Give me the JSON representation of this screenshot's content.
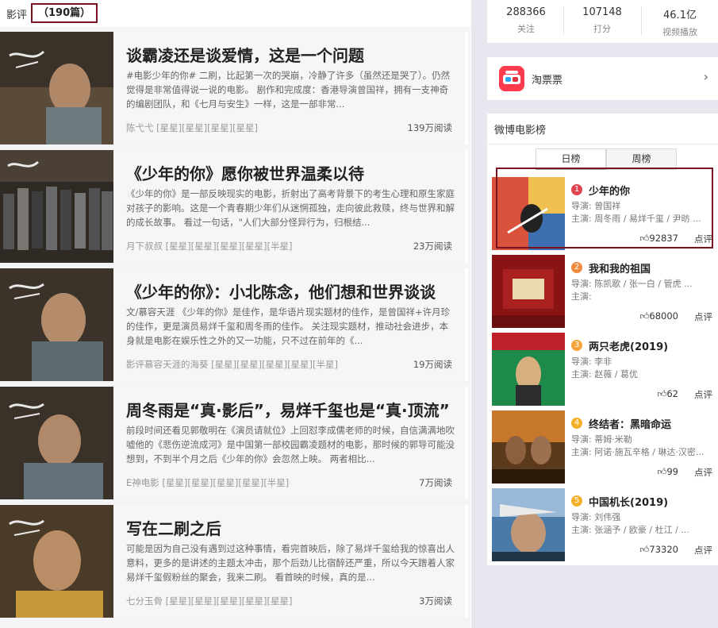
{
  "reviews_header": {
    "title": "影评",
    "count": "（190篇）"
  },
  "reviews": [
    {
      "title": "谈霸凌还是谈爱情，这是一个问题",
      "excerpt": "#电影少年的你# 二刷，比起第一次的哭崩，冷静了许多（虽然还是哭了）。仍然觉得是非常值得说一说的电影。  剧作和完成度：香港导演曾国祥，拥有一支神奇的编剧团队，和《七月与安生》一样，这是一部非常...",
      "author": "陈弋弋 [星星][星星][星星][星星]",
      "reads": "139万阅读"
    },
    {
      "title": "《少年的你》愿你被世界温柔以待",
      "excerpt": "《少年的你》是一部反映现实的电影，折射出了高考背景下的考生心理和原生家庭对孩子的影响。这是一个青春期少年们从迷惘孤独，走向彼此救赎，终与世界和解的成长故事。 看过一句话，\"人们大部分怪异行为，归根结...",
      "author": "月下叔叔 [星星][星星][星星][星星][半星]",
      "reads": "23万阅读"
    },
    {
      "title": "《少年的你》：小北陈念，他们想和世界谈谈",
      "excerpt": "文/慕容天涯 《少年的你》是佳作，是华语片现实题材的佳作，是曾国祥+许月珍的佳作，更是演员易烊千玺和周冬雨的佳作。 关注现实题材，推动社会进步，本身就是电影在娱乐性之外的又一功能，只不过在前年的《...",
      "author": "影评慕容天涯的海葵 [星星][星星][星星][星星][半星]",
      "reads": "19万阅读"
    },
    {
      "title": "周冬雨是“真·影后”，易烊千玺也是“真·顶流”",
      "excerpt": "前段时间还看见郭敬明在《演员请就位》上回怼李成儒老师的时候，自信满满地吹嘘他的《悲伤逆流成河》是中国第一部校园霸凌题材的电影，那时候的郭导可能没想到，不到半个月之后《少年的你》会忽然上映。 两者相比...",
      "author": "E神电影 [星星][星星][星星][星星][半星]",
      "reads": "7万阅读"
    },
    {
      "title": "写在二刷之后",
      "excerpt": "可能是因为自己没有遇到过这种事情，看完首映后，除了易烊千玺给我的惊喜出人意料，更多的是讲述的主题太冲击，那个后劲儿比宿醉还严重，所以今天蹭着人家易烊千玺假粉丝的聚会，我来二刷。 看首映的时候，真的是...",
      "author": "七分玉骨 [星星][星星][星星][星星][星星]",
      "reads": "3万阅读"
    }
  ],
  "stats": [
    {
      "value": "288366",
      "label": "关注"
    },
    {
      "value": "107148",
      "label": "打分"
    },
    {
      "value": "46.1亿",
      "label": "视频播放"
    }
  ],
  "taopiaopiao": {
    "name": "淘票票",
    "arrow": "›"
  },
  "ranking": {
    "title": "微博电影榜",
    "tabs": {
      "day": "日榜",
      "week": "周榜"
    },
    "comment_label": "点评",
    "movies": [
      {
        "rank": "1",
        "title": "少年的你",
        "director": "导演: 曾国祥",
        "cast": "主演: 周冬雨 / 易烊千玺 / 尹昉 ...",
        "likes": "92837"
      },
      {
        "rank": "2",
        "title": "我和我的祖国",
        "director": "导演: 陈凯歌 / 张一白 / 管虎 ...",
        "cast": "主演:",
        "likes": "68000"
      },
      {
        "rank": "3",
        "title": "两只老虎(2019)",
        "director": "导演: 李非",
        "cast": "主演: 赵薇 / 葛优",
        "likes": "62"
      },
      {
        "rank": "4",
        "title": "终结者：黑暗命运",
        "director": "导演: 蒂姆·米勒",
        "cast": "主演: 阿诺·施瓦辛格 / 琳达·汉密...",
        "likes": "99"
      },
      {
        "rank": "5",
        "title": "中国机长(2019)",
        "director": "导演: 刘伟强",
        "cast": "主演: 张涵予 / 欧豪 / 杜江 / ...",
        "likes": "73320"
      }
    ]
  },
  "colors": {
    "highlight_border": "#7a1220",
    "rank_1": "#e0454f",
    "rank_2": "#f08a3c",
    "rank_3": "#f5a33a",
    "rank_4": "#f5b02a",
    "rank_5": "#f5b02a",
    "taopiaopiao_brand": "#ff3b4e"
  }
}
